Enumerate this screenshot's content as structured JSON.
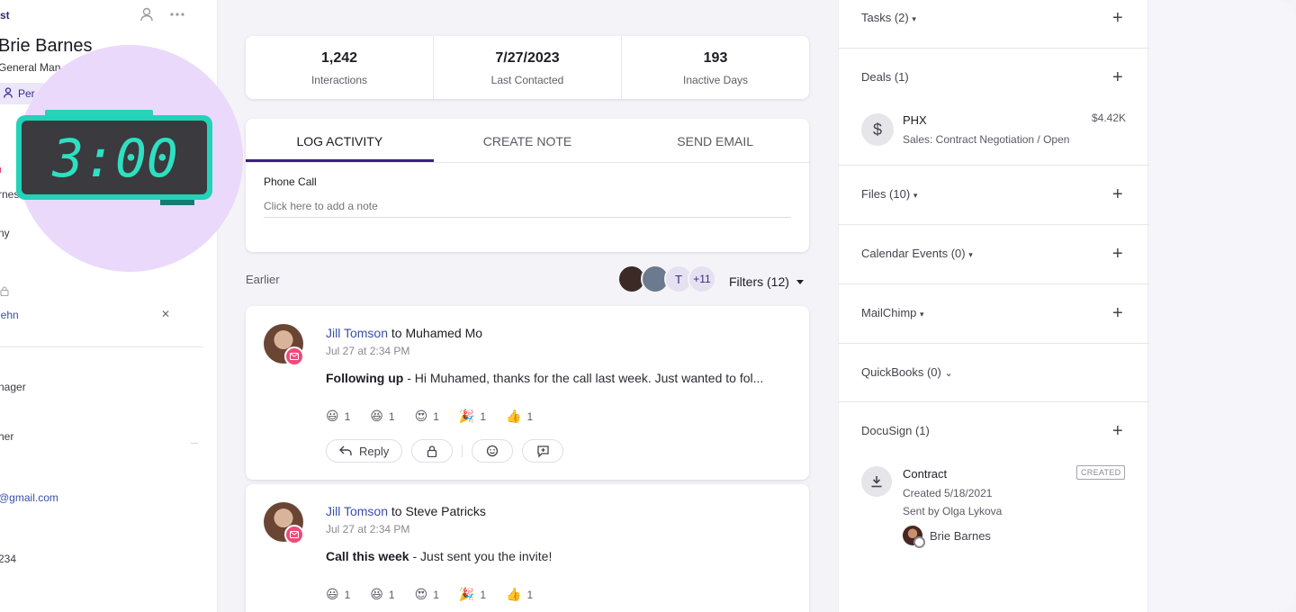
{
  "left": {
    "crumb": "st",
    "name": "Brie Barnes",
    "role": "General Man",
    "persona": "Per",
    "frag_arnes": "rnes",
    "frag_ny": "ny",
    "frag_link": "iehn",
    "frag_manager": "nager",
    "frag_her": "her",
    "frag_email": "@gmail.com",
    "frag_phone": "234"
  },
  "clock": {
    "time": "3:00"
  },
  "stats": [
    {
      "value": "1,242",
      "label": "Interactions"
    },
    {
      "value": "7/27/2023",
      "label": "Last Contacted"
    },
    {
      "value": "193",
      "label": "Inactive Days"
    }
  ],
  "activity": {
    "tabs": [
      "LOG ACTIVITY",
      "CREATE NOTE",
      "SEND EMAIL"
    ],
    "type": "Phone Call",
    "placeholder": "Click here to add a note"
  },
  "feed": {
    "section": "Earlier",
    "avatar_t": "T",
    "avatar_more": "+11",
    "filters": "Filters (12)",
    "items": [
      {
        "from": "Jill Tomson",
        "to_text": " to Muhamed Mo",
        "time": "Jul 27 at 2:34 PM",
        "subject": "Following up",
        "body": "  -  Hi Muhamed, thanks for the call last week. Just wanted to fol..."
      },
      {
        "from": "Jill Tomson",
        "to_text": " to Steve Patricks",
        "time": "Jul 27 at 2:34 PM",
        "subject": "Call this week",
        "body": "  -  Just sent you the invite!"
      }
    ],
    "reactions": [
      "😃",
      "😆",
      "😍",
      "🎉",
      "👍"
    ],
    "reaction_count": "1",
    "reply": "Reply"
  },
  "right": {
    "tasks": "Tasks (2)",
    "deals": "Deals (1)",
    "deal_name": "PHX",
    "deal_sub": "Sales: Contract Negotiation / Open",
    "deal_amount": "$4.42K",
    "files": "Files (10)",
    "calendar": "Calendar Events (0)",
    "mailchimp": "MailChimp",
    "quickbooks": "QuickBooks (0)",
    "docusign": "DocuSign (1)",
    "ds_name": "Contract",
    "ds_created": "Created 5/18/2021",
    "ds_sent": "Sent by Olga Lykova",
    "ds_badge": "CREATED",
    "ds_signer": "Brie Barnes"
  }
}
